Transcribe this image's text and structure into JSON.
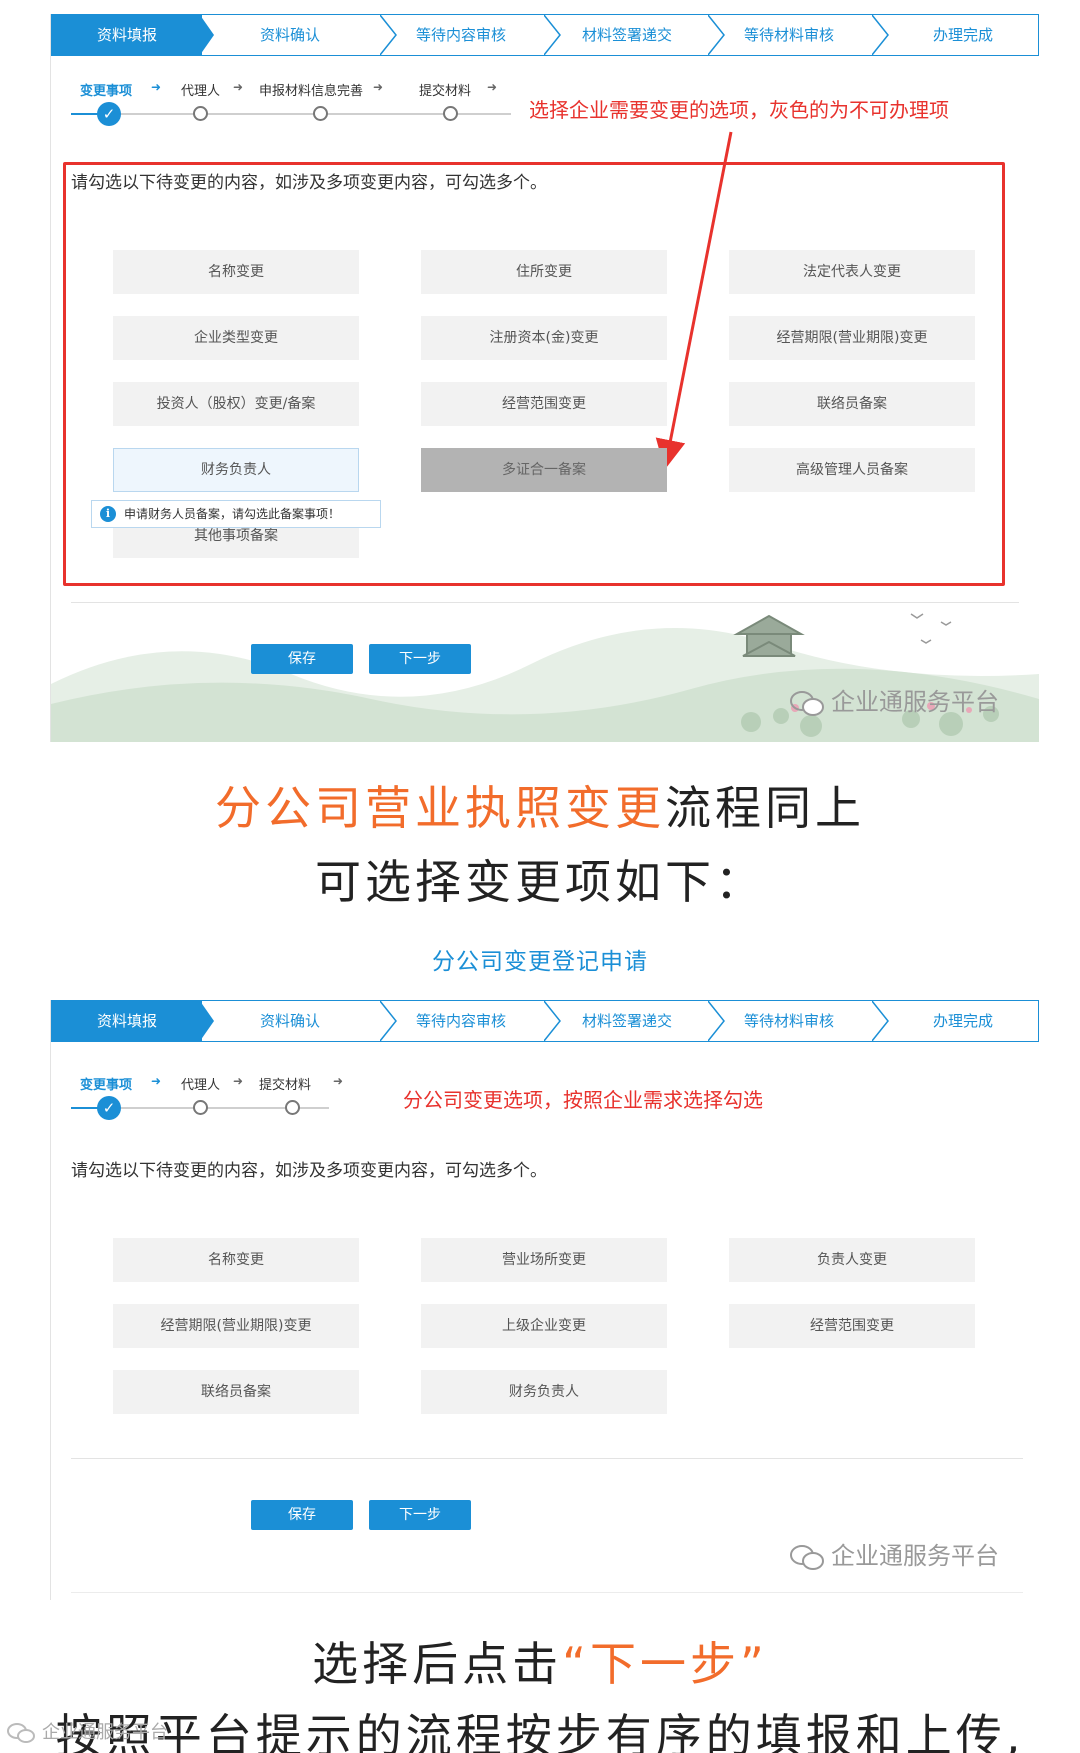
{
  "progress_steps": [
    "资料填报",
    "资料确认",
    "等待内容审核",
    "材料签署递交",
    "等待材料审核",
    "办理完成"
  ],
  "shot1": {
    "substeps": [
      "变更事项",
      "代理人",
      "申报材料信息完善",
      "提交材料"
    ],
    "annotation": "选择企业需要变更的选项，灰色的为不可办理项",
    "intro": "请勾选以下待变更的内容，如涉及多项变更内容，可勾选多个。",
    "options": {
      "r1c1": "名称变更",
      "r1c2": "住所变更",
      "r1c3": "法定代表人变更",
      "r2c1": "企业类型变更",
      "r2c2": "注册资本(金)变更",
      "r2c3": "经营期限(营业期限)变更",
      "r3c1": "投资人（股权）变更/备案",
      "r3c2": "经营范围变更",
      "r3c3": "联络员备案",
      "r4c1": "财务负责人",
      "r4c2": "多证合一备案",
      "r4c3": "高级管理人员备案",
      "r5c1": "其他事项备案"
    },
    "tip": "申请财务人员备案，请勾选此备案事项！",
    "buttons": {
      "save": "保存",
      "next": "下一步"
    },
    "watermark": "企业通服务平台"
  },
  "caption1": {
    "highlight": "分公司营业执照变更",
    "rest": "流程同上"
  },
  "caption2": "可选择变更项如下：",
  "subheading": "分公司变更登记申请",
  "shot2": {
    "substeps": [
      "变更事项",
      "代理人",
      "提交材料"
    ],
    "annotation": "分公司变更选项，按照企业需求选择勾选",
    "intro": "请勾选以下待变更的内容，如涉及多项变更内容，可勾选多个。",
    "options": {
      "r1c1": "名称变更",
      "r1c2": "营业场所变更",
      "r1c3": "负责人变更",
      "r2c1": "经营期限(营业期限)变更",
      "r2c2": "上级企业变更",
      "r2c3": "经营范围变更",
      "r3c1": "联络员备案",
      "r3c2": "财务负责人"
    },
    "buttons": {
      "save": "保存",
      "next": "下一步"
    },
    "watermark": "企业通服务平台"
  },
  "caption3": {
    "before": "选择后点击",
    "quote_open": "“",
    "highlight": "下一步",
    "quote_close": "”"
  },
  "caption4": "按照平台提示的流程按步有序的填报和上传,",
  "corner_logo": "企业通服务平台",
  "colors": {
    "accent_blue": "#1b8fd6",
    "annotation_red": "#e8322d",
    "caption_orange": "#f26c2b",
    "disabled_gray": "#b3b3b3"
  }
}
